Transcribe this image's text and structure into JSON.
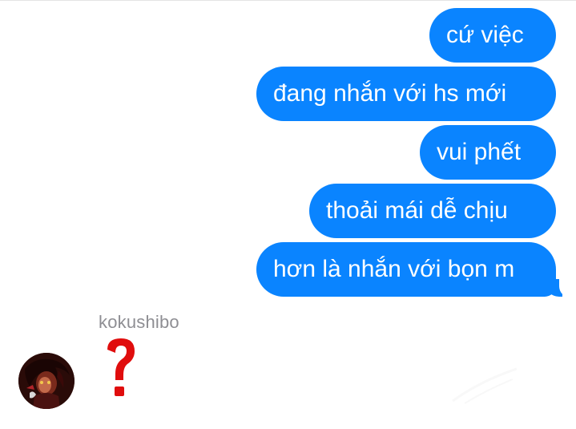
{
  "thread": {
    "outgoing_messages": [
      {
        "text": "cứ việc"
      },
      {
        "text": "đang nhắn với hs mới"
      },
      {
        "text": "vui phết"
      },
      {
        "text": "thoải mái dễ chịu"
      },
      {
        "text": "hơn là nhắn với bọn m"
      }
    ],
    "incoming": {
      "sender_name": "kokushibo",
      "reaction_symbol": "?"
    }
  },
  "colors": {
    "outgoing_bubble": "#0a84ff",
    "outgoing_text": "#ffffff",
    "sender_name_text": "#8e8e93",
    "question_mark": "#e00d0d",
    "background": "#ffffff"
  },
  "icons": {
    "avatar": "profile-avatar",
    "reaction": "red-question-mark-icon"
  }
}
